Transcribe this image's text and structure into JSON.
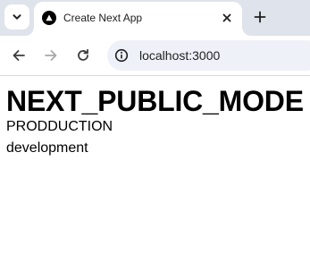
{
  "browser": {
    "tab": {
      "title": "Create Next App",
      "favicon": "nextjs-logo-icon"
    },
    "tab_strip_color": "#dfe3eb",
    "omnibox": {
      "url": "localhost:3000",
      "info_icon": "site-info-icon",
      "background": "#eef1f8"
    },
    "icons": {
      "tab_search": "chevron-down-icon",
      "close": "close-icon",
      "new_tab": "plus-icon",
      "back": "back-arrow-icon",
      "forward": "forward-arrow-icon",
      "reload": "reload-icon"
    }
  },
  "page": {
    "heading": "NEXT_PUBLIC_MODE",
    "lines": [
      "PRODDUCTION",
      "development"
    ]
  }
}
